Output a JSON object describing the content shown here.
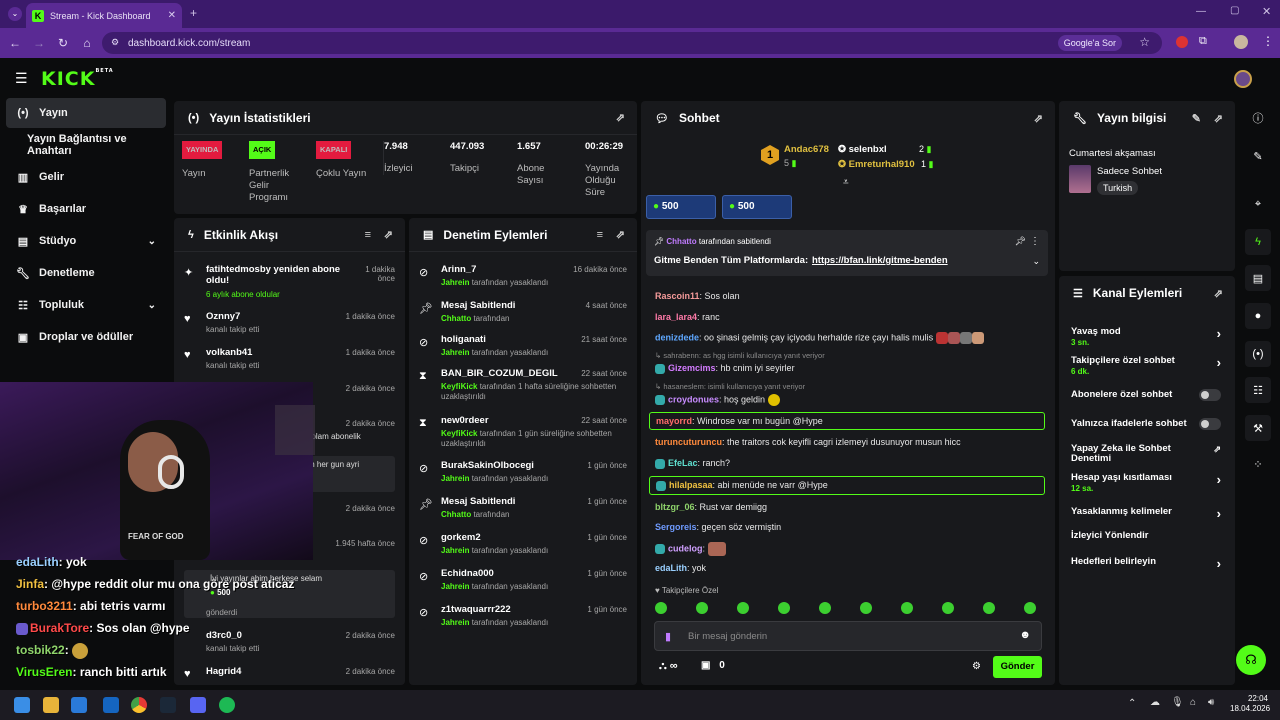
{
  "browser": {
    "tab_title": "Stream - Kick Dashboard",
    "url": "dashboard.kick.com/stream",
    "google_btn": "Google'a Sor"
  },
  "sidebar": {
    "items": [
      {
        "label": "Yayın",
        "icon": "broadcast-icon"
      },
      {
        "label": "Yayın Bağlantısı ve Anahtarı"
      },
      {
        "label": "Gelir",
        "icon": "chart-icon"
      },
      {
        "label": "Başarılar",
        "icon": "trophy-icon"
      },
      {
        "label": "Stüdyo",
        "icon": "studio-icon"
      },
      {
        "label": "Denetleme",
        "icon": "wrench-icon"
      },
      {
        "label": "Topluluk",
        "icon": "community-icon"
      },
      {
        "label": "Droplar ve ödüller",
        "icon": "gift-icon"
      }
    ]
  },
  "stats": {
    "title": "Yayın İstatistikleri",
    "status": [
      {
        "badge": "YAYINDA",
        "label": "Yayın"
      },
      {
        "badge": "AÇIK",
        "label": "Partnerlik Gelir Programı"
      },
      {
        "badge": "KAPALI",
        "label": "Çoklu Yayın"
      }
    ],
    "values": [
      {
        "value": "7.948",
        "label": "İzleyici"
      },
      {
        "value": "447.093",
        "label": "Takipçi"
      },
      {
        "value": "1.657",
        "label": "Abone Sayısı"
      },
      {
        "value": "00:26:29",
        "label": "Yayında Olduğu Süre"
      }
    ]
  },
  "activity": {
    "title": "Etkinlik Akışı",
    "items": [
      {
        "title": "fatihtedmosby yeniden abone oldu!",
        "sub": "6 aylık abone oldular",
        "time": "1 dakika önce"
      },
      {
        "title": "Oznny7",
        "sub": "kanalı takip etti",
        "time": "1 dakika önce"
      },
      {
        "title": "volkanb41",
        "sub": "kanalı takip etti",
        "time": "1 dakika önce"
      },
      {
        "title": "",
        "sub": "",
        "time": "2 dakika önce"
      },
      {
        "title": "r! Toplam abonelik",
        "sub": "",
        "time": "2 dakika önce"
      },
      {
        "title": "ctigin her gun ayri",
        "sub": "",
        "time": ""
      },
      {
        "title": "",
        "sub": "",
        "time": "2 dakika önce"
      },
      {
        "title": "",
        "sub": "",
        "time": "1.945 hafta önce"
      },
      {
        "title": "İyi yayınlar abim herkese selam",
        "sub": "500",
        "time": ""
      },
      {
        "title": "gönderdi",
        "sub": "",
        "time": ""
      },
      {
        "title": "d3rc0_0",
        "sub": "kanalı takip etti",
        "time": "2 dakika önce"
      },
      {
        "title": "Hagrid4",
        "sub": "",
        "time": "2 dakika önce"
      }
    ]
  },
  "moderation": {
    "title": "Denetim Eylemleri",
    "items": [
      {
        "title": "Arinn_7",
        "who": "Jahrein",
        "sub": "tarafından yasaklandı",
        "time": "16 dakika önce",
        "icon": "ban-icon"
      },
      {
        "title": "Mesaj Sabitlendi",
        "who": "Chhatto",
        "sub": "tarafından",
        "time": "4 saat önce",
        "icon": "pin-icon"
      },
      {
        "title": "holiganati",
        "who": "Jahrein",
        "sub": "tarafından yasaklandı",
        "time": "21 saat önce",
        "icon": "ban-icon"
      },
      {
        "title": "BAN_BIR_COZUM_DEGIL",
        "who": "KeyfiKick",
        "sub": "tarafından 1 hafta süreliğine sohbetten uzaklaştırıldı",
        "time": "22 saat önce",
        "icon": "hourglass-icon"
      },
      {
        "title": "new0rdeer",
        "who": "KeyfiKick",
        "sub": "tarafından 1 gün süreliğine sohbetten uzaklaştırıldı",
        "time": "22 saat önce",
        "icon": "hourglass-icon"
      },
      {
        "title": "BurakSakinOlbocegi",
        "who": "Jahrein",
        "sub": "tarafından yasaklandı",
        "time": "1 gün önce",
        "icon": "ban-icon"
      },
      {
        "title": "Mesaj Sabitlendi",
        "who": "Chhatto",
        "sub": "tarafından",
        "time": "1 gün önce",
        "icon": "pin-icon"
      },
      {
        "title": "gorkem2",
        "who": "Jahrein",
        "sub": "tarafından yasaklandı",
        "time": "1 gün önce",
        "icon": "ban-icon"
      },
      {
        "title": "Echidna000",
        "who": "Jahrein",
        "sub": "tarafından yasaklandı",
        "time": "1 gün önce",
        "icon": "ban-icon"
      },
      {
        "title": "z1twaquarrr222",
        "who": "Jahrein",
        "sub": "tarafından yasaklandı",
        "time": "1 gün önce",
        "icon": "ban-icon"
      }
    ]
  },
  "chat": {
    "title": "Sohbet",
    "leaders": [
      {
        "name": "Andac678",
        "rank": "1",
        "count": "5"
      },
      {
        "name": "selenbxl",
        "count": "2"
      },
      {
        "name": "Emreturhal910",
        "count": "1"
      }
    ],
    "gifts": [
      "500",
      "500"
    ],
    "pinned": {
      "by": "Chhatto",
      "by_suffix": "tarafından sabitlendi",
      "text": "Gitme Benden Tüm Platformlarda:",
      "link": "https://bfan.link/gitme-benden"
    },
    "messages": [
      {
        "user": "Rascoin11",
        "color": "#f59a9a",
        "text": "Sos olan"
      },
      {
        "user": "lara_lara4",
        "color": "#ff7aa8",
        "text": "ranc"
      },
      {
        "user": "denizdede",
        "color": "#5fa8ff",
        "text": "oo şinasi gelmiş çay içiyodu herhalde rize çayı halis mulis"
      },
      {
        "user": "",
        "color": "#888",
        "text": "sahrabenn: as hgg isimli kullanıcıya yanıt veriyor"
      },
      {
        "user": "Gizemcims",
        "color": "#d37cff",
        "text": "hb cnim iyi seyirler"
      },
      {
        "user": "",
        "color": "#888",
        "text": "hasaneslem: isimli kullanıcıya yanıt veriyor"
      },
      {
        "user": "croydonues",
        "color": "#c88cff",
        "text": "hoş geldin"
      },
      {
        "user": "mayorrd",
        "color": "#ff6b6b",
        "text": "Windrose var mı bugün @Hype"
      },
      {
        "user": "turuncuturuncu",
        "color": "#ff8a3d",
        "text": "the traitors cok keyifli cagri izlemeyi dusunuyor musun hicc"
      },
      {
        "user": "EfeLac",
        "color": "#5fe0d0",
        "text": "ranch?"
      },
      {
        "user": "hilalpasaa",
        "color": "#f0c040",
        "text": "abi menüde ne varr @Hype"
      },
      {
        "user": "bltzgr_06",
        "color": "#8fd46b",
        "text": "Rust var demiigg"
      },
      {
        "user": "Sergoreis",
        "color": "#6f9bff",
        "text": "geçen söz vermiştin"
      },
      {
        "user": "cudelog",
        "color": "#d0a0ff",
        "text": ""
      },
      {
        "user": "edaLith",
        "color": "#9ad0ff",
        "text": "yok"
      }
    ],
    "followers_only": "Takipçilere Özel",
    "input_placeholder": "Bir mesaj gönderin",
    "infinity": "∞",
    "box_count": "0",
    "send": "Gönder"
  },
  "streaminfo": {
    "title": "Yayın bilgisi",
    "stream_title": "Cumartesi akşaması",
    "category": "Sadece Sohbet",
    "tag": "Turkish"
  },
  "channel": {
    "title": "Kanal Eylemleri",
    "items": [
      {
        "label": "Yavaş mod",
        "sub": "3 sn.",
        "type": "arrow"
      },
      {
        "label": "Takipçilere özel sohbet",
        "sub": "6 dk.",
        "type": "arrow"
      },
      {
        "label": "Abonelere özel sohbet",
        "sub": "",
        "type": "toggle"
      },
      {
        "label": "Yalnızca ifadelerle sohbet",
        "sub": "",
        "type": "toggle"
      },
      {
        "label": "Yapay Zeka ile Sohbet Denetimi",
        "sub": "",
        "type": "link"
      },
      {
        "label": "Hesap yaşı kısıtlaması",
        "sub": "12 sa.",
        "type": "arrow"
      },
      {
        "label": "Yasaklanmış kelimeler",
        "sub": "",
        "type": "arrow"
      },
      {
        "label": "İzleyici Yönlendir",
        "sub": "",
        "type": "none"
      },
      {
        "label": "Hedefleri belirleyin",
        "sub": "",
        "type": "arrow"
      }
    ]
  },
  "overlay_chat": [
    {
      "user": "edaLith",
      "text": ": yok",
      "color": "#9ad0ff"
    },
    {
      "user": "Jinfa",
      "text": ": @hype reddit olur mu ona göre post aticaz",
      "color": "#f0c040"
    },
    {
      "user": "turbo3211",
      "text": ": abi tetris varmı",
      "color": "#ff8a3d"
    },
    {
      "user": "BurakTore",
      "text": ": Sos olan @hype",
      "color": "#ff4a4a"
    },
    {
      "user": "tosbik22",
      "text": ":",
      "color": "#8fd46b"
    },
    {
      "user": "VirusEren",
      "text": ": ranch bitti artık",
      "color": "#53fc18"
    }
  ],
  "taskbar": {
    "time": "22:04",
    "date": "18.04.2026"
  },
  "colors": {
    "accent": "#53fc18",
    "panel": "#18191c",
    "bg": "#0b0c0d",
    "live": "#e31b3f"
  }
}
